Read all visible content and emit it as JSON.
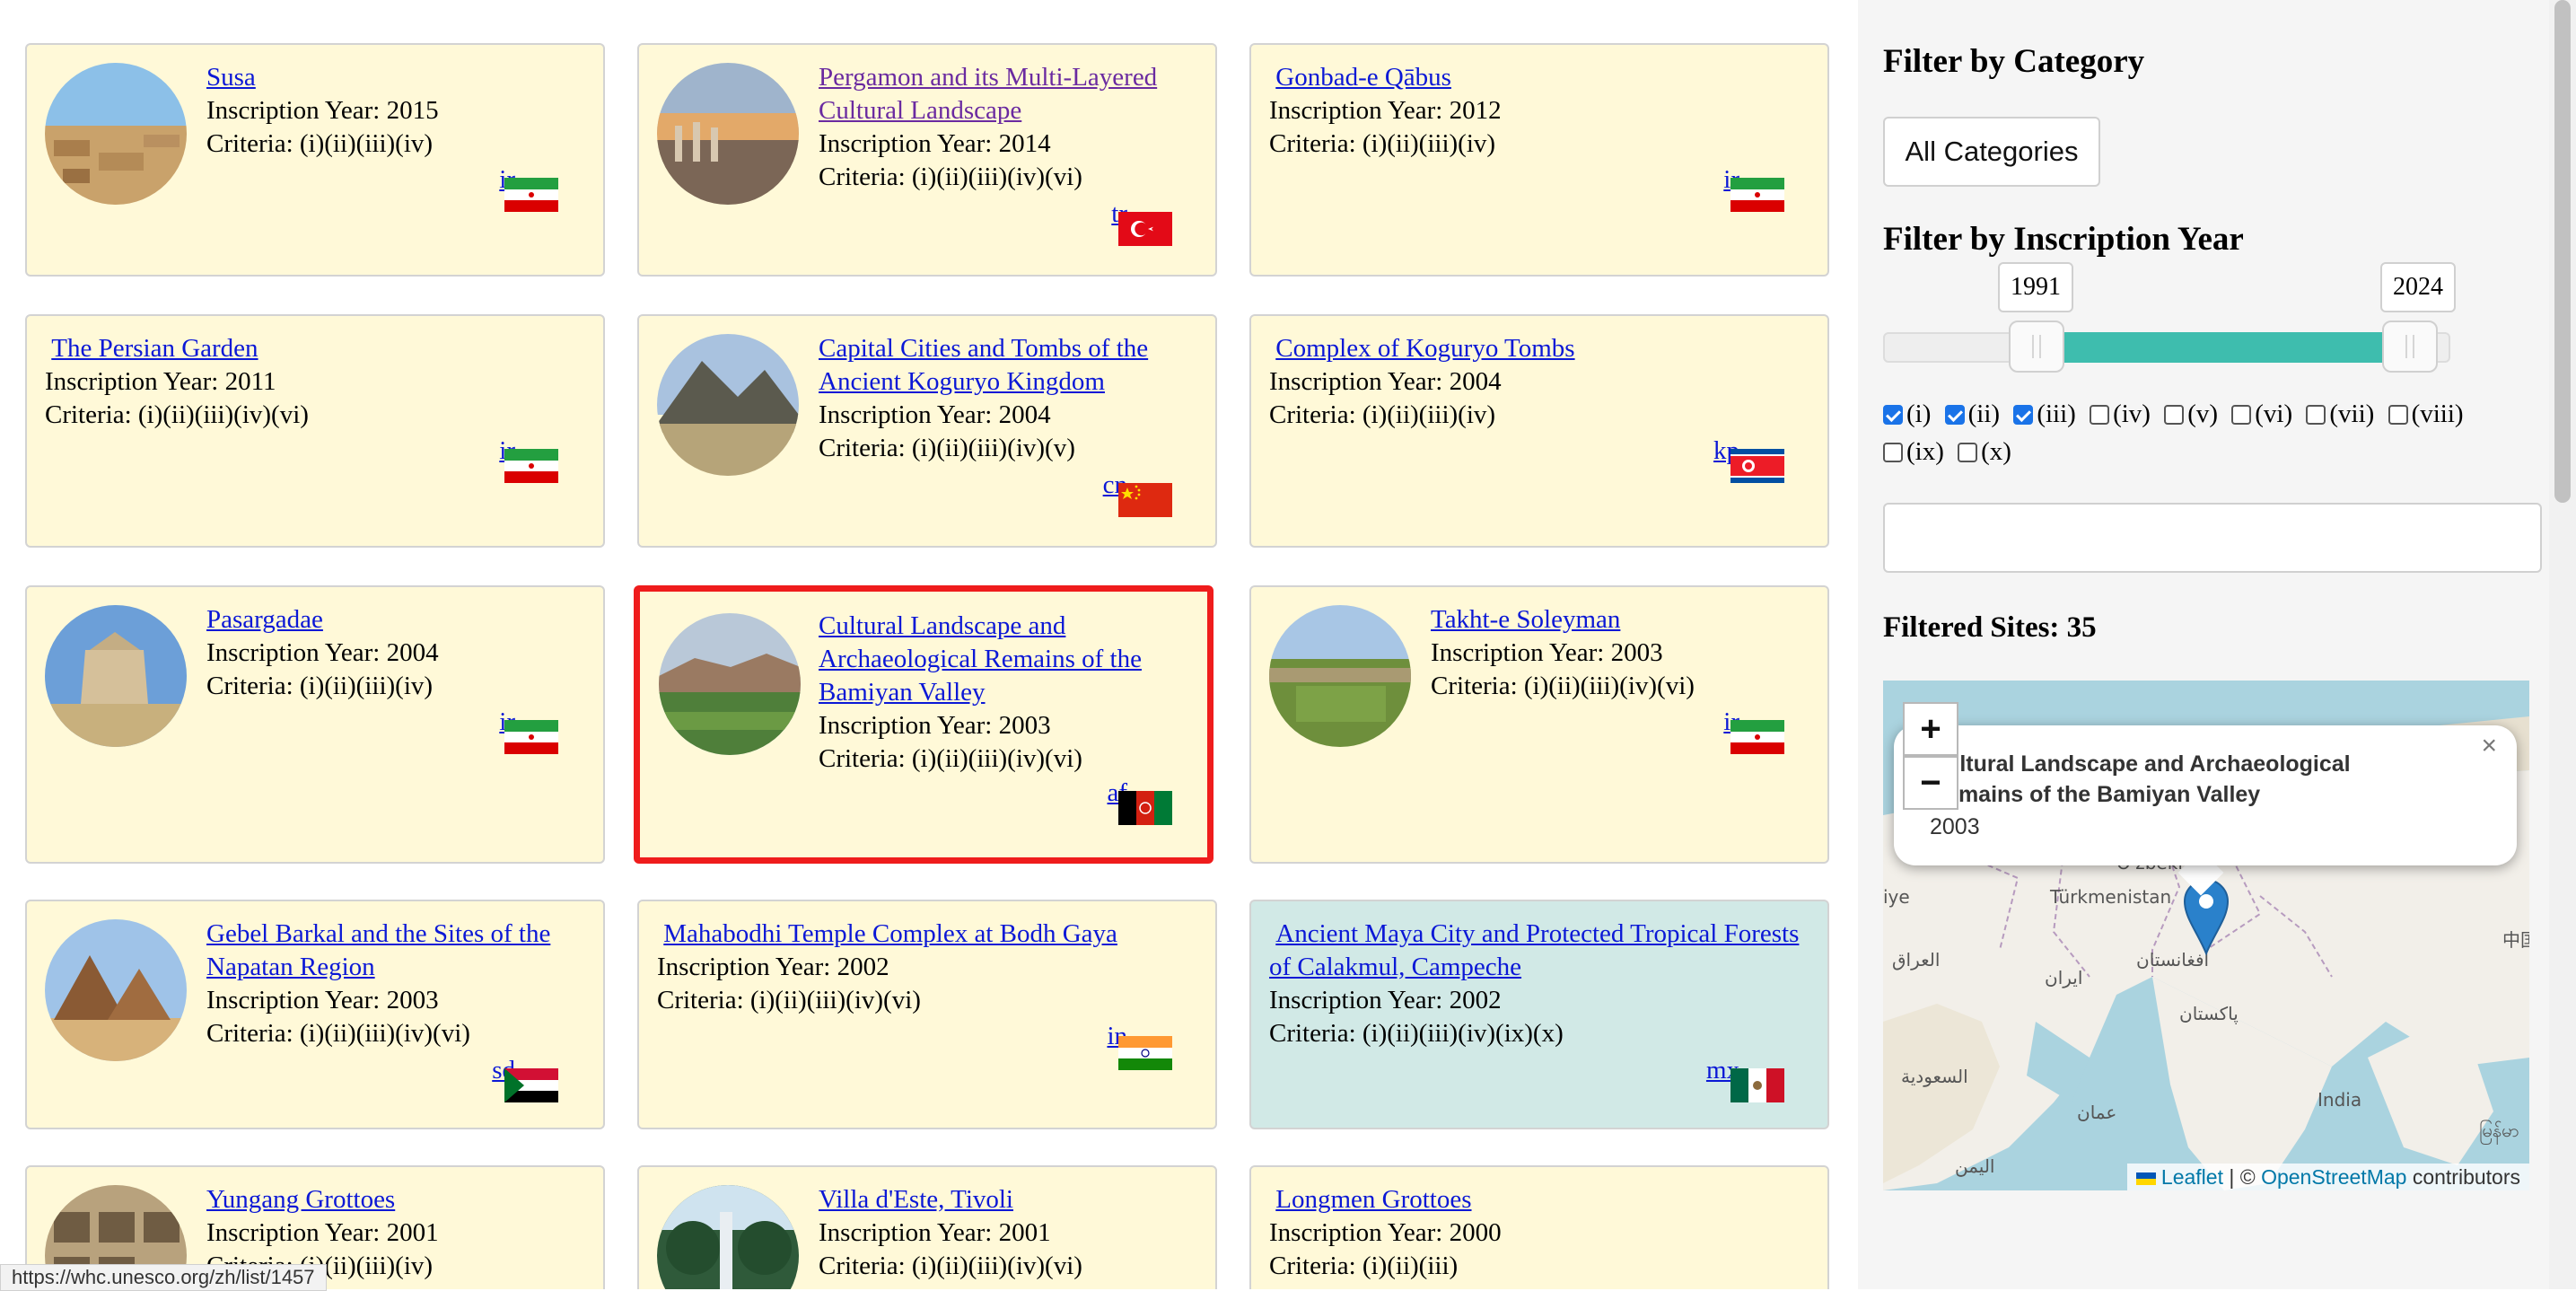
{
  "sites": [
    {
      "name": "Susa",
      "year_text": "Inscription Year: 2015",
      "criteria_text": "Criteria: (i)(ii)(iii)(iv)",
      "country": "ir"
    },
    {
      "name": "Pergamon and its Multi-Layered Cultural Landscape",
      "year_text": "Inscription Year: 2014",
      "criteria_text": "Criteria: (i)(ii)(iii)(iv)(vi)",
      "country": "tr"
    },
    {
      "name": "Gonbad-e Qābus",
      "year_text": "Inscription Year: 2012",
      "criteria_text": "Criteria: (i)(ii)(iii)(iv)",
      "country": "ir"
    },
    {
      "name": "The Persian Garden",
      "year_text": "Inscription Year: 2011",
      "criteria_text": "Criteria: (i)(ii)(iii)(iv)(vi)",
      "country": "ir"
    },
    {
      "name": "Capital Cities and Tombs of the Ancient Koguryo Kingdom",
      "year_text": "Inscription Year: 2004",
      "criteria_text": "Criteria: (i)(ii)(iii)(iv)(v)",
      "country": "cn"
    },
    {
      "name": "Complex of Koguryo Tombs",
      "year_text": "Inscription Year: 2004",
      "criteria_text": "Criteria: (i)(ii)(iii)(iv)",
      "country": "kp"
    },
    {
      "name": "Pasargadae",
      "year_text": "Inscription Year: 2004",
      "criteria_text": "Criteria: (i)(ii)(iii)(iv)",
      "country": "ir"
    },
    {
      "name": "Cultural Landscape and Archaeological Remains of the Bamiyan Valley",
      "year_text": "Inscription Year: 2003",
      "criteria_text": "Criteria: (i)(ii)(iii)(iv)(vi)",
      "country": "af"
    },
    {
      "name": "Takht-e Soleyman",
      "year_text": "Inscription Year: 2003",
      "criteria_text": "Criteria: (i)(ii)(iii)(iv)(vi)",
      "country": "ir"
    },
    {
      "name": "Gebel Barkal and the Sites of the Napatan Region",
      "year_text": "Inscription Year: 2003",
      "criteria_text": "Criteria: (i)(ii)(iii)(iv)(vi)",
      "country": "sd"
    },
    {
      "name": "Mahabodhi Temple Complex at Bodh Gaya",
      "year_text": "Inscription Year: 2002",
      "criteria_text": "Criteria: (i)(ii)(iii)(iv)(vi)",
      "country": "in"
    },
    {
      "name": "Ancient Maya City and Protected Tropical Forests of Calakmul, Campeche",
      "year_text": "Inscription Year: 2002",
      "criteria_text": "Criteria: (i)(ii)(iii)(iv)(ix)(x)",
      "country": "mx"
    },
    {
      "name": "Yungang Grottoes",
      "year_text": "Inscription Year: 2001",
      "criteria_text": "Criteria: (i)(ii)(iii)(iv)",
      "country": ""
    },
    {
      "name": "Villa d'Este, Tivoli",
      "year_text": "Inscription Year: 2001",
      "criteria_text": "Criteria: (i)(ii)(iii)(iv)(vi)",
      "country": ""
    },
    {
      "name": "Longmen Grottoes",
      "year_text": "Inscription Year: 2000",
      "criteria_text": "Criteria: (i)(ii)(iii)",
      "country": ""
    }
  ],
  "sidebar": {
    "category_heading": "Filter by Category",
    "category_button": "All Categories",
    "year_heading": "Filter by Inscription Year",
    "year_min": "1991",
    "year_max": "2024",
    "criteria": [
      {
        "label": "(i)",
        "checked": true
      },
      {
        "label": "(ii)",
        "checked": true
      },
      {
        "label": "(iii)",
        "checked": true
      },
      {
        "label": "(iv)",
        "checked": false
      },
      {
        "label": "(v)",
        "checked": false
      },
      {
        "label": "(vi)",
        "checked": false
      },
      {
        "label": "(vii)",
        "checked": false
      },
      {
        "label": "(viii)",
        "checked": false
      },
      {
        "label": "(ix)",
        "checked": false
      },
      {
        "label": "(x)",
        "checked": false
      }
    ],
    "filtered_sites": "Filtered Sites: 35"
  },
  "map": {
    "zoom_in": "+",
    "zoom_out": "−",
    "popup_title": "Cultural Landscape and Archaeological Remains of the Bamiyan Valley",
    "popup_year": "2003",
    "popup_close": "×",
    "labels": {
      "turkmenistan": "Türkmenistan",
      "uzbekistan": "O'zbekis",
      "iraq": "العراق",
      "iran": "ایران",
      "afghanistan": "افغانستان",
      "pakistan": "پاکستان",
      "saudi": "السعودية",
      "oman": "عمان",
      "yemen": "اليمن",
      "india": "India",
      "china": "中国",
      "myanmar": "မြန်မာ",
      "syria": "iye"
    },
    "attribution_leaflet": "Leaflet",
    "attribution_rest": " | © ",
    "attribution_osm": "OpenStreetMap",
    "attribution_tail": " contributors"
  },
  "status_url": "https://whc.unesco.org/zh/list/1457",
  "colors": {
    "card_bg": "#fff9d8",
    "card_teal_bg": "#d1e9e6",
    "link": "#0b18d6",
    "selected_border": "#ef1c1c",
    "slider_range": "#3ebdae"
  }
}
